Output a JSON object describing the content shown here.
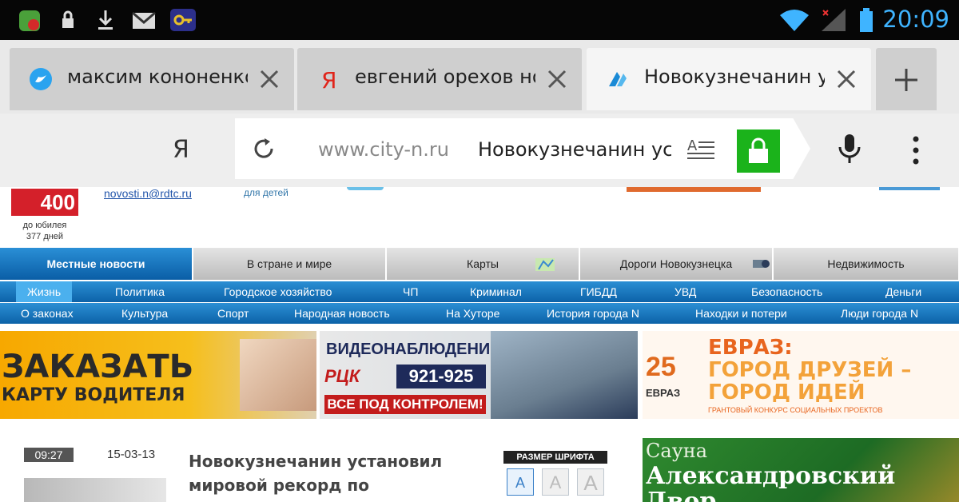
{
  "statusbar": {
    "time": "20:09"
  },
  "tabs": [
    {
      "title": "максим кононенко",
      "favicon": "twitter-icon",
      "active": false
    },
    {
      "title": "евгений орехов новокузнецк",
      "favicon": "yandex-icon",
      "active": false
    },
    {
      "title": "Новокузнечанин установил",
      "favicon": "city-n-icon",
      "active": true
    }
  ],
  "toolbar": {
    "yandex_label": "Я",
    "url_domain": "www.city-n.ru",
    "url_title": "Новокузнечанин установил"
  },
  "site": {
    "logo": "400",
    "jubilee_line1": "до юбилея",
    "jubilee_line2": "377 дней",
    "email": "novosti.n@rdtc.ru",
    "kids_link": "для детей",
    "main_nav": [
      "Местные новости",
      "В стране и мире",
      "Карты",
      "Дороги Новокузнецка",
      "Недвижимость"
    ],
    "sub_nav_1": [
      "Жизнь",
      "Политика",
      "Городское хозяйство",
      "ЧП",
      "Криминал",
      "ГИБДД",
      "УВД",
      "Безопасность",
      "Деньги"
    ],
    "sub_nav_2": [
      "О законах",
      "Культура",
      "Спорт",
      "Народная новость",
      "На Хуторе",
      "История города N",
      "Находки и потери",
      "Люди города N"
    ]
  },
  "banners": {
    "driver_card": {
      "line1": "ЗАКАЗАТЬ",
      "line2": "КАРТУ ВОДИТЕЛЯ"
    },
    "cctv": {
      "title": "ВИДЕОНАБЛЮДЕНИЕ",
      "brand": "РЦК",
      "phone": "921-925",
      "tagline": "ВСЕ ПОД КОНТРОЛЕМ!"
    },
    "evraz": {
      "number": "25",
      "brand": "ЕВРАЗ",
      "title": "ЕВРАЗ:",
      "line1": "ГОРОД ДРУЗЕЙ –",
      "line2": "ГОРОД ИДЕЙ",
      "sub": "ГРАНТОВЫЙ КОНКУРС СОЦИАЛЬНЫХ ПРОЕКТОВ"
    },
    "sauna": {
      "line1": "Сауна",
      "line2": "Александровский",
      "line3": "Двор"
    }
  },
  "article": {
    "time": "09:27",
    "date": "15-03-13",
    "headline": "Новокузнечанин установил мировой рекорд по"
  },
  "font_size": {
    "label": "РАЗМЕР ШРИФТА",
    "options": [
      "A",
      "A",
      "A"
    ]
  },
  "colors": {
    "accent_blue": "#0a5ea6",
    "lock_green": "#1bb31b",
    "clock_blue": "#3fb4ff"
  }
}
